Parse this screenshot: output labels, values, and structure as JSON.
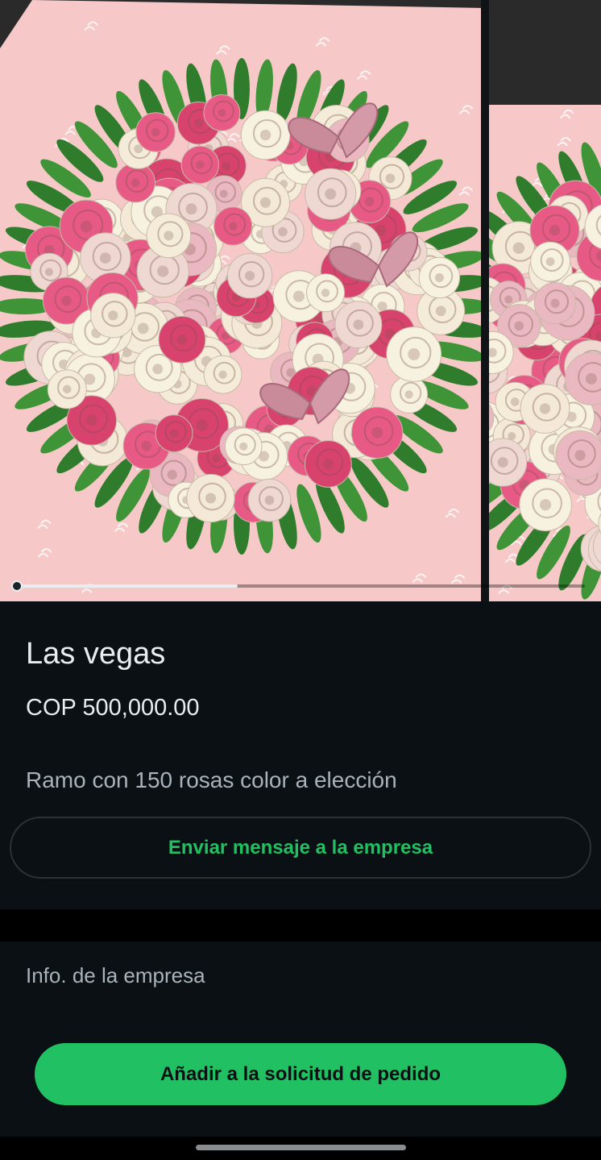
{
  "product": {
    "name": "Las vegas",
    "price": "COP 500,000.00",
    "description": "Ramo con 150 rosas color a elección"
  },
  "carousel": {
    "image_count": 2,
    "current_index": 1,
    "progress_fraction": 0.39,
    "images": [
      "pink-roses-bouquet-image",
      "pink-roses-bouquet-image-2"
    ]
  },
  "actions": {
    "message_label": "Enviar mensaje a la empresa",
    "add_to_order_label": "Añadir a la solicitud de pedido"
  },
  "business": {
    "info_label": "Info. de la empresa"
  },
  "colors": {
    "background": "#0b1014",
    "accent": "#21c063",
    "text_primary": "#e9edef",
    "text_secondary": "#a9b3ba",
    "wrapping_pink": "#f6c9c8"
  }
}
